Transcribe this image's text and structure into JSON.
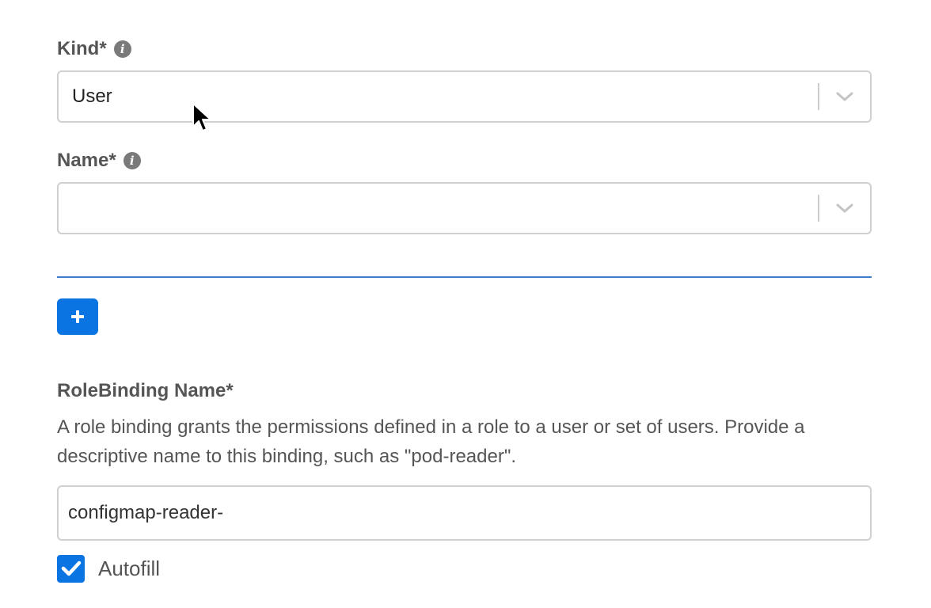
{
  "kind": {
    "label": "Kind*",
    "info_icon": "info-icon",
    "value": "User"
  },
  "name": {
    "label": "Name*",
    "info_icon": "info-icon",
    "value": ""
  },
  "add_button": {
    "icon": "plus-icon"
  },
  "rolebinding": {
    "label": "RoleBinding Name*",
    "help": "A role binding grants the permissions defined in a role to a user or set of users. Provide a descriptive name to this binding, such as \"pod-reader\".",
    "value": "configmap-reader-"
  },
  "autofill": {
    "label": "Autofill",
    "checked": true
  },
  "colors": {
    "accent": "#0a74e3",
    "divider": "#3d7ccb",
    "border": "#d0d0d0"
  }
}
